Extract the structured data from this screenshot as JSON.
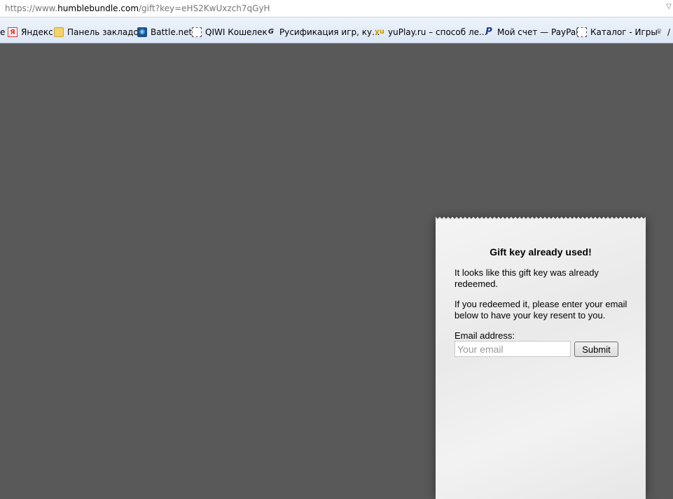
{
  "address_bar": {
    "url_prefix": "https://www.",
    "url_host": "humblebundle.com",
    "url_path": "/gift?key=eHS2KwUxzch7qGyH",
    "dropdown_icon": "chevron-down-icon"
  },
  "bookmarks": [
    {
      "label": "e",
      "icon": ""
    },
    {
      "label": "Яндекс",
      "icon": "Я"
    },
    {
      "label": "Панель закладок",
      "icon": ""
    },
    {
      "label": "Battle.net",
      "icon": "◉"
    },
    {
      "label": "QIWI Кошелек",
      "icon": ""
    },
    {
      "label": "Русификация игр, ку...",
      "icon": "G"
    },
    {
      "label": "yuPlay.ru – способ ле...",
      "icon": "yu"
    },
    {
      "label": "Мой счет — PayPal",
      "icon": "P"
    },
    {
      "label": "Каталог - Игры",
      "icon": ""
    },
    {
      "label": "/",
      "icon": "♛"
    }
  ],
  "receipt": {
    "title": "Gift key already used!",
    "paragraph1": "It looks like this gift key was already redeemed.",
    "paragraph2": "If you redeemed it, please enter your email below to have your key resent to you.",
    "email_label": "Email address:",
    "email_placeholder": "Your email",
    "email_value": "",
    "submit_label": "Submit"
  },
  "colors": {
    "page_background": "#595959",
    "receipt_paper": "#eeeeee"
  }
}
